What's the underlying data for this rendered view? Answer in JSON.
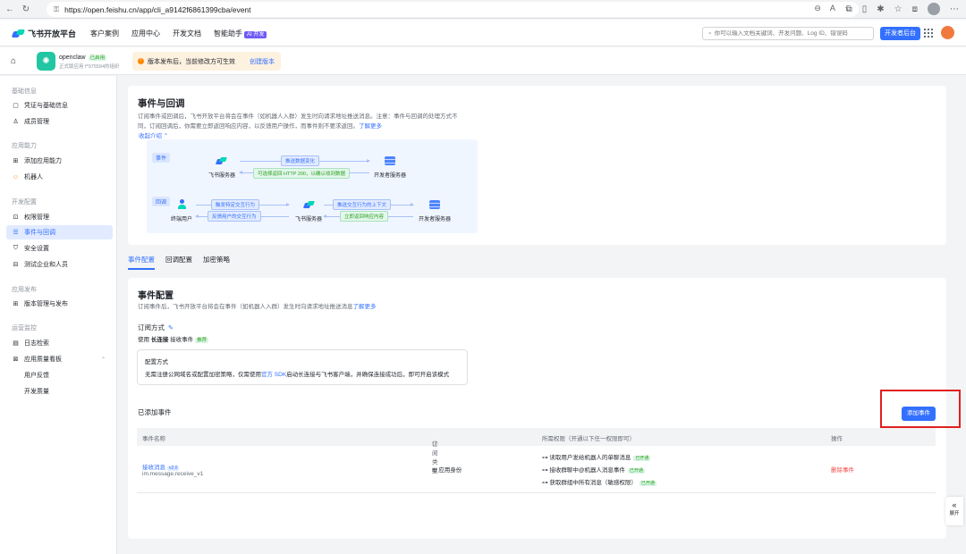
{
  "browser": {
    "url": "https://open.feishu.cn/app/cli_a9142f6861399cba/event"
  },
  "topnav": {
    "brand": "飞书开放平台",
    "links": [
      "客户案例",
      "应用中心",
      "开发文档",
      "智能助手"
    ],
    "ai_badge": "AI 开发",
    "search_placeholder": "你可以输入文档关键词、开发问题、Log ID、错误码",
    "dev_console": "开发者后台"
  },
  "appbar": {
    "app_name": "openclaw",
    "app_status": "已启用",
    "app_sub": "正式版应用 f*975594的组织",
    "notice": "版本发布后，当前修改方可生效",
    "notice_link": "创建版本"
  },
  "sidebar": {
    "groups": [
      "基础信息",
      "应用能力",
      "开发配置",
      "应用发布",
      "运营监控"
    ],
    "items": [
      {
        "label": "凭证与基础信息",
        "icon": "▢"
      },
      {
        "label": "成员管理",
        "icon": "♙"
      },
      {
        "label": "添加应用能力",
        "icon": "⊞"
      },
      {
        "label": "机器人",
        "icon": "☺"
      },
      {
        "label": "权限管理",
        "icon": "⊡"
      },
      {
        "label": "事件与回调",
        "icon": "☰"
      },
      {
        "label": "安全设置",
        "icon": "⛉"
      },
      {
        "label": "测试企业和人员",
        "icon": "⊟"
      },
      {
        "label": "版本管理与发布",
        "icon": "⊞"
      },
      {
        "label": "日志检索",
        "icon": "▤"
      },
      {
        "label": "应用质量看板",
        "icon": "⊠"
      },
      {
        "label": "用户反馈",
        "icon": ""
      },
      {
        "label": "开发质量",
        "icon": ""
      }
    ]
  },
  "intro": {
    "title": "事件与回调",
    "desc1": "订阅事件或回调后，飞书开放平台将会在事件（如机器人入群）发生时向请求地址推送消息。注意：事件与回调的处理方式不",
    "desc2": "同，订阅回调后，你需要立即返回响应内容，以反馈用户操作，而事件则不要求返回。",
    "learn_more": "了解更多",
    "collapse": "收起介绍",
    "event_tag": "事件",
    "callback_tag": "回调",
    "feishu_server": "飞书服务器",
    "dev_server": "开发者服务器",
    "end_user": "终端用户",
    "push_change": "推送数据变化",
    "return_200": "可选择返回 HTTP 200，以确认收到数据",
    "trigger": "触发特定交互行为",
    "feedback": "反馈用户的交互行为",
    "push_context": "推送交互行为的上下文",
    "immediate": "立即返回响应内容"
  },
  "tabs": [
    "事件配置",
    "回调配置",
    "加密策略"
  ],
  "event_config": {
    "title": "事件配置",
    "desc": "订阅事件后，飞书开放平台将会在事件（如机器人入群）发生时向请求地址推送消息",
    "learn_more": "了解更多",
    "sub_mode_label": "订阅方式",
    "use": "使用",
    "long_conn": "长连接",
    "receive": "接收事件",
    "recommended": "推荐",
    "config_title": "配置方式",
    "config_desc_a": "无需注册公网域名或配置加密策略，仅需使用",
    "sdk_link": "官方 SDK",
    "config_desc_b": "启动长连接与飞书客户端，并确保连接成功后，即可开启该模式",
    "added_title": "已添加事件",
    "add_button": "添加事件"
  },
  "table": {
    "headers": [
      "事件名称",
      "订阅类型",
      "所需权限（开通以下任一权限即可）",
      "操作"
    ],
    "rows": [
      {
        "name": "接收消息",
        "version": "v2.0",
        "id": "im.message.receive_v1",
        "sub_type": "应用身份",
        "perms": [
          {
            "label": "读取用户发给机器人的单聊消息",
            "status": "已开通"
          },
          {
            "label": "接收群聊中@机器人消息事件",
            "status": "已开通"
          },
          {
            "label": "获取群组中所有消息（敏感权限）",
            "status": "已开通"
          }
        ],
        "action": "删除事件"
      }
    ]
  },
  "expand": "展开"
}
